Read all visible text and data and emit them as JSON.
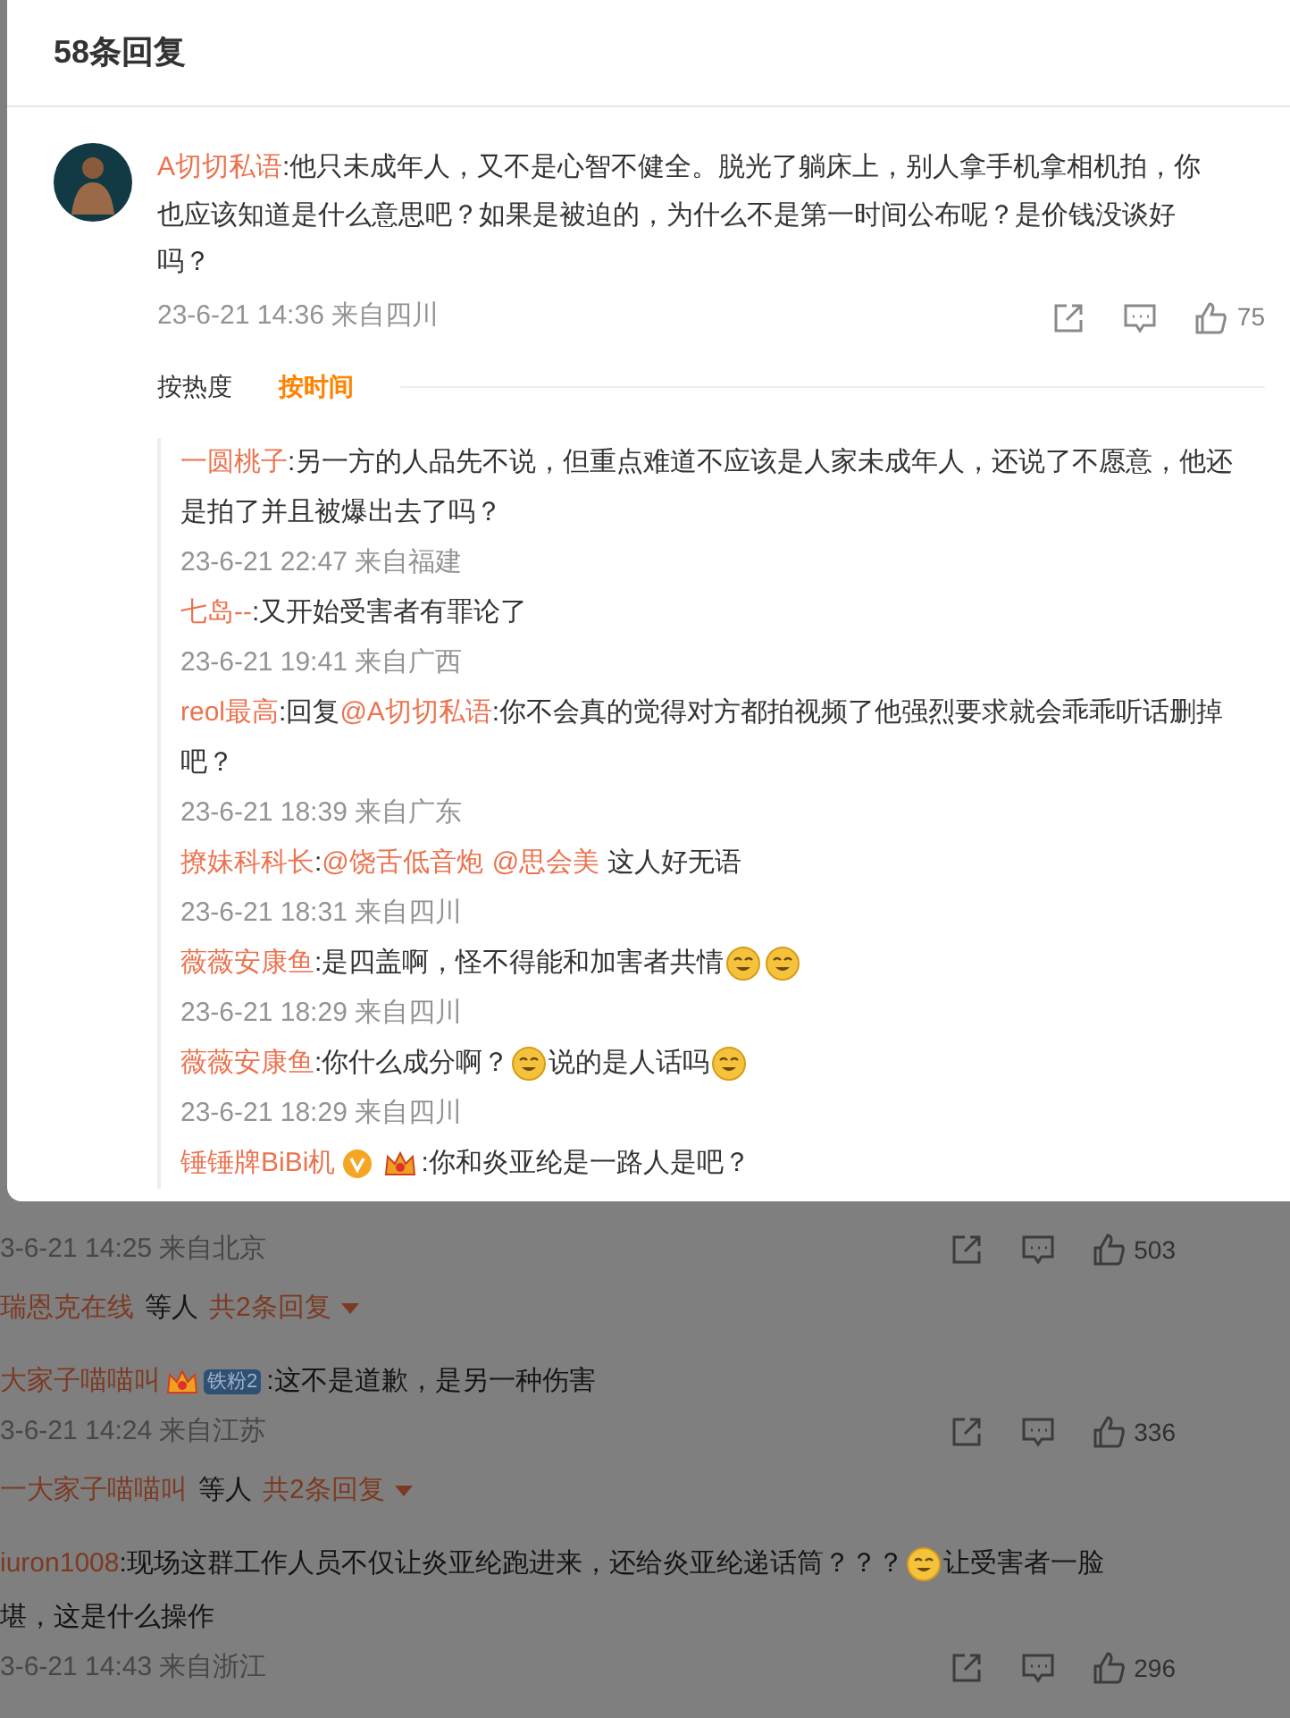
{
  "background": {
    "comments": [
      {
        "time": "3-6-21 14:25 来自北京",
        "likes": "503",
        "summary": {
          "user": "瑞恩克在线",
          "suffix": "等人",
          "count": "共2条回复"
        }
      },
      {
        "lines": [
          [
            {
              "kind": "user",
              "text": "大家子喵喵叫"
            },
            {
              "kind": "crown"
            },
            {
              "kind": "fan",
              "text": "铁粉2"
            },
            {
              "kind": "text",
              "text": ":这不是道歉，是另一种伤害"
            }
          ]
        ],
        "time": "3-6-21 14:24 来自江苏",
        "likes": "336",
        "summary": {
          "user": "一大家子喵喵叫",
          "suffix": "等人",
          "count": "共2条回复"
        }
      },
      {
        "lines": [
          [
            {
              "kind": "user",
              "text": "iuron1008"
            },
            {
              "kind": "text",
              "text": ":现场这群工作人员不仅让炎亚纶跑进来，还给炎亚纶递话筒？？？"
            },
            {
              "kind": "emoji"
            },
            {
              "kind": "text",
              "text": "让受害者一脸"
            }
          ],
          [
            {
              "kind": "text",
              "text": "堪，这是什么操作"
            }
          ]
        ],
        "time": "3-6-21 14:43 来自浙江",
        "likes": "296"
      }
    ]
  },
  "dialog": {
    "title": "58条回复",
    "comment": {
      "user": "A切切私语",
      "text": ":他只未成年人，又不是心智不健全。脱光了躺床上，别人拿手机拿相机拍，你也应该知道是什么意思吧？如果是被迫的，为什么不是第一时间公布呢？是价钱没谈好吗？",
      "time": "23-6-21 14:36 来自四川",
      "likes": "75"
    },
    "sort_tabs": [
      {
        "label": "按热度",
        "selected": false
      },
      {
        "label": "按时间",
        "selected": true
      }
    ],
    "replies": [
      {
        "parts": [
          {
            "kind": "user",
            "text": "一圆桃子"
          },
          {
            "kind": "text",
            "text": ":另一方的人品先不说，但重点难道不应该是人家未成年人，还说了不愿意，他还是拍了并且被爆出去了吗？"
          }
        ],
        "time": "23-6-21 22:47 来自福建"
      },
      {
        "parts": [
          {
            "kind": "user",
            "text": "七岛--"
          },
          {
            "kind": "text",
            "text": ":又开始受害者有罪论了"
          }
        ],
        "time": "23-6-21 19:41 来自广西"
      },
      {
        "parts": [
          {
            "kind": "user",
            "text": "reol最高"
          },
          {
            "kind": "text",
            "text": ":回复"
          },
          {
            "kind": "mention",
            "text": "@A切切私语"
          },
          {
            "kind": "text",
            "text": ":你不会真的觉得对方都拍视频了他强烈要求就会乖乖听话删掉吧？"
          }
        ],
        "time": "23-6-21 18:39 来自广东"
      },
      {
        "parts": [
          {
            "kind": "user",
            "text": "撩妹科科长"
          },
          {
            "kind": "text",
            "text": ":"
          },
          {
            "kind": "mention",
            "text": "@饶舌低音炮"
          },
          {
            "kind": "mention",
            "text": "@思会美"
          },
          {
            "kind": "text",
            "text": " 这人好无语"
          }
        ],
        "time": "23-6-21 18:31 来自四川"
      },
      {
        "parts": [
          {
            "kind": "user",
            "text": "薇薇安康鱼"
          },
          {
            "kind": "text",
            "text": ":是四盖啊，怪不得能和加害者共情"
          },
          {
            "kind": "emoji"
          },
          {
            "kind": "emoji"
          }
        ],
        "time": "23-6-21 18:29 来自四川"
      },
      {
        "parts": [
          {
            "kind": "user",
            "text": "薇薇安康鱼"
          },
          {
            "kind": "text",
            "text": ":你什么成分啊？"
          },
          {
            "kind": "emoji"
          },
          {
            "kind": "text",
            "text": "说的是人话吗"
          },
          {
            "kind": "emoji"
          }
        ],
        "time": "23-6-21 18:29 来自四川"
      },
      {
        "parts": [
          {
            "kind": "user",
            "text": "锤锤牌BiBi机"
          },
          {
            "kind": "verified"
          },
          {
            "kind": "crown"
          },
          {
            "kind": "text",
            "text": ":你和炎亚纶是一路人是吧？"
          }
        ]
      }
    ]
  }
}
